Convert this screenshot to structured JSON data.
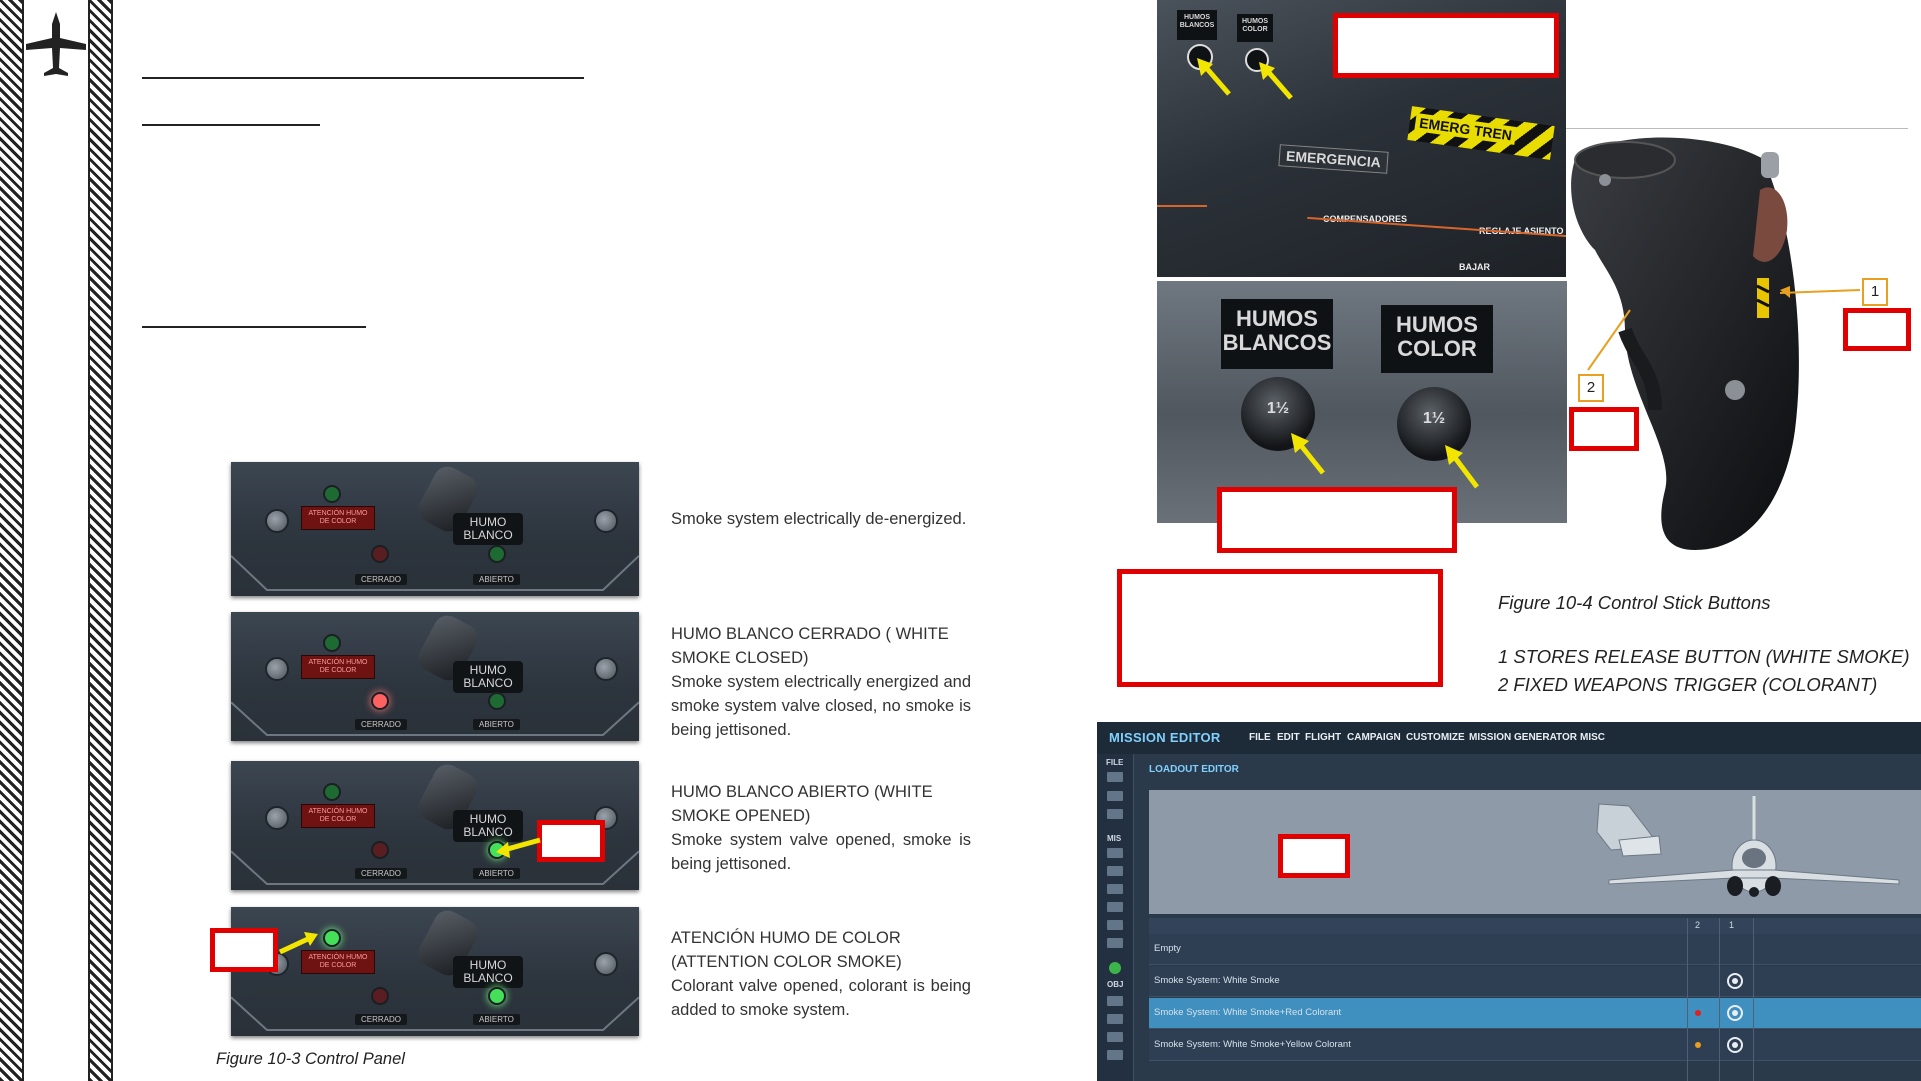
{
  "control_panel_states": [
    {
      "title": "",
      "body": "Smoke system electrically de-energized.",
      "white_closed_lamp": "off",
      "white_open_lamp": "off",
      "color_lamp": "off"
    },
    {
      "title": "HUMO BLANCO CERRADO ( WHITE SMOKE CLOSED)",
      "body": "Smoke system electrically energized and smoke system valve closed, no smoke is being jettisoned.",
      "white_closed_lamp": "on",
      "white_open_lamp": "off",
      "color_lamp": "off"
    },
    {
      "title": "HUMO BLANCO ABIERTO (WHITE SMOKE OPENED)",
      "body": "Smoke system valve opened, smoke is being jettisoned.",
      "white_closed_lamp": "off",
      "white_open_lamp": "on",
      "color_lamp": "off"
    },
    {
      "title": "ATENCIÓN HUMO DE COLOR (ATTENTION COLOR SMOKE)",
      "body": "Colorant valve opened, colorant is being added to smoke system.",
      "white_closed_lamp": "off",
      "white_open_lamp": "on",
      "color_lamp": "on"
    }
  ],
  "panel_labels": {
    "humo_blanco": "HUMO BLANCO",
    "atencion": "ATENCIÓN HUMO DE COLOR",
    "cerrado": "CERRADO",
    "abierto": "ABIERTO"
  },
  "figure_10_3_caption": "Figure 10-3 Control Panel",
  "cockpit_photo_labels": {
    "humos_blancos_small": "HUMOS BLANCOS",
    "humos_color_small": "HUMOS COLOR",
    "emerg_tren": "EMERG TREN",
    "emergencia": "EMERGENCIA",
    "compensadores": "COMPENSADORES",
    "reglaje_asiento": "REGLAJE ASIENTO",
    "bajar": "BAJAR",
    "humos_blancos": "HUMOS BLANCOS",
    "humos_color": "HUMOS COLOR",
    "knob_marking": "1½"
  },
  "figure_10_4": {
    "caption": "Figure 10-4 Control Stick Buttons",
    "item_1": "1 STORES RELEASE BUTTON (WHITE SMOKE)",
    "item_2": "2 FIXED WEAPONS TRIGGER (COLORANT)",
    "callout_1": "1",
    "callout_2": "2"
  },
  "mission_editor": {
    "title": "MISSION EDITOR",
    "menu": [
      "FILE",
      "EDIT",
      "FLIGHT",
      "CAMPAIGN",
      "CUSTOMIZE",
      "MISSION GENERATOR",
      "MISC"
    ],
    "sidebar_file": "FILE",
    "sidebar_mis": "MIS",
    "sidebar_obj": "OBJ",
    "subtitle": "LOADOUT EDITOR",
    "pylon_headers": [
      "2",
      "1"
    ],
    "rows": [
      {
        "label": "Empty",
        "selected": false,
        "dot_color": ""
      },
      {
        "label": "Smoke System: White Smoke",
        "selected": false,
        "dot_color": ""
      },
      {
        "label": "Smoke System: White Smoke+Red Colorant",
        "selected": true,
        "dot_color": "#e02020"
      },
      {
        "label": "Smoke System: White Smoke+Yellow Colorant",
        "selected": false,
        "dot_color": "#e8a020"
      }
    ],
    "colors": {
      "accent": "#7fd0ff",
      "selected_row": "#3f8fbf"
    }
  }
}
